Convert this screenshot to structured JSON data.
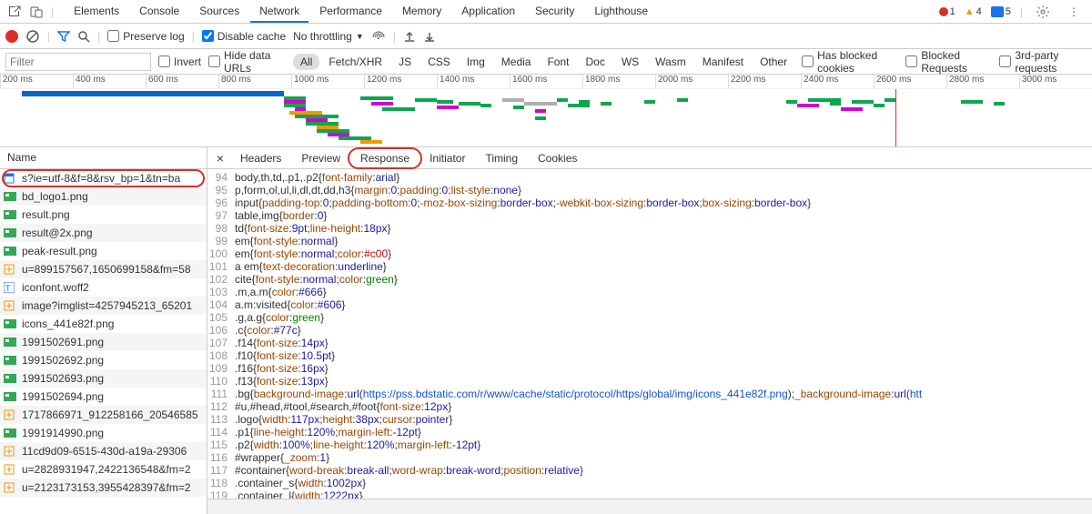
{
  "top_tabs": {
    "items": [
      "Elements",
      "Console",
      "Sources",
      "Network",
      "Performance",
      "Memory",
      "Application",
      "Security",
      "Lighthouse"
    ],
    "active_index": 3
  },
  "top_right": {
    "errors": "1",
    "warnings": "4",
    "messages": "5"
  },
  "net_toolbar": {
    "preserve_log": "Preserve log",
    "disable_cache": "Disable cache",
    "throttling": "No throttling"
  },
  "filter_bar": {
    "filter_placeholder": "Filter",
    "invert": "Invert",
    "hide_data_urls": "Hide data URLs",
    "types": [
      "All",
      "Fetch/XHR",
      "JS",
      "CSS",
      "Img",
      "Media",
      "Font",
      "Doc",
      "WS",
      "Wasm",
      "Manifest",
      "Other"
    ],
    "has_blocked_cookies": "Has blocked cookies",
    "blocked_requests": "Blocked Requests",
    "third_party": "3rd-party requests"
  },
  "timeline_ticks": [
    "200 ms",
    "400 ms",
    "600 ms",
    "800 ms",
    "1000 ms",
    "1200 ms",
    "1400 ms",
    "1600 ms",
    "1800 ms",
    "2000 ms",
    "2200 ms",
    "2400 ms",
    "2600 ms",
    "2800 ms",
    "3000 ms"
  ],
  "name_header": "Name",
  "requests": [
    {
      "icon": "doc",
      "name": "s?ie=utf-8&f=8&rsv_bp=1&tn=ba"
    },
    {
      "icon": "img",
      "name": "bd_logo1.png"
    },
    {
      "icon": "img",
      "name": "result.png"
    },
    {
      "icon": "img",
      "name": "result@2x.png"
    },
    {
      "icon": "img",
      "name": "peak-result.png"
    },
    {
      "icon": "other",
      "name": "u=899157567,1650699158&fm=58"
    },
    {
      "icon": "font",
      "name": "iconfont.woff2"
    },
    {
      "icon": "other",
      "name": "image?imglist=4257945213_65201"
    },
    {
      "icon": "img",
      "name": "icons_441e82f.png"
    },
    {
      "icon": "img",
      "name": "1991502691.png"
    },
    {
      "icon": "img",
      "name": "1991502692.png"
    },
    {
      "icon": "img",
      "name": "1991502693.png"
    },
    {
      "icon": "img",
      "name": "1991502694.png"
    },
    {
      "icon": "other",
      "name": "1717866971_912258166_20546585"
    },
    {
      "icon": "img",
      "name": "1991914990.png"
    },
    {
      "icon": "other",
      "name": "11cd9d09-6515-430d-a19a-29306"
    },
    {
      "icon": "other",
      "name": "u=2828931947,2422136548&fm=2"
    },
    {
      "icon": "other",
      "name": "u=2123173153,3955428397&fm=2"
    }
  ],
  "detail_tabs": {
    "items": [
      "Headers",
      "Preview",
      "Response",
      "Initiator",
      "Timing",
      "Cookies"
    ],
    "active_index": 2
  },
  "code_lines": [
    {
      "n": 94,
      "html": "body,th,td,.p1,.p2{<span class='prop'>font-family</span>:<span class='val'>arial</span>}"
    },
    {
      "n": 95,
      "html": "p,form,ol,ul,li,dl,dt,dd,h3{<span class='prop'>margin</span>:<span class='num'>0</span>;<span class='prop'>padding</span>:<span class='num'>0</span>;<span class='prop'>list-style</span>:<span class='val'>none</span>}"
    },
    {
      "n": 96,
      "html": "input{<span class='prop'>padding-top</span>:<span class='num'>0</span>;<span class='prop'>padding-bottom</span>:<span class='num'>0</span>;<span class='prop'>-moz-box-sizing</span>:<span class='val'>border-box</span>;<span class='prop'>-webkit-box-sizing</span>:<span class='val'>border-box</span>;<span class='prop'>box-sizing</span>:<span class='val'>border-box</span>}"
    },
    {
      "n": 97,
      "html": "table,img{<span class='prop'>border</span>:<span class='num'>0</span>}"
    },
    {
      "n": 98,
      "html": "td{<span class='prop'>font-size</span>:<span class='num'>9pt</span>;<span class='prop'>line-height</span>:<span class='num'>18px</span>}"
    },
    {
      "n": 99,
      "html": "em{<span class='prop'>font-style</span>:<span class='val'>normal</span>}"
    },
    {
      "n": 100,
      "html": "em{<span class='prop'>font-style</span>:<span class='val'>normal</span>;<span class='prop'>color</span>:<span class='sel'>#c00</span>}"
    },
    {
      "n": 101,
      "html": "a em{<span class='prop'>text-decoration</span>:<span class='val'>underline</span>}"
    },
    {
      "n": 102,
      "html": "cite{<span class='prop'>font-style</span>:<span class='val'>normal</span>;<span class='prop'>color</span>:<span class='green'>green</span>}"
    },
    {
      "n": 103,
      "html": ".m,a.m{<span class='prop'>color</span>:<span class='hexc'>#666</span>}"
    },
    {
      "n": 104,
      "html": "a.m:visited{<span class='prop'>color</span>:<span class='hexc'>#606</span>}"
    },
    {
      "n": 105,
      "html": ".g,a.g{<span class='prop'>color</span>:<span class='green'>green</span>}"
    },
    {
      "n": 106,
      "html": ".c{<span class='prop'>color</span>:<span class='hexc'>#77c</span>}"
    },
    {
      "n": 107,
      "html": ".f14{<span class='prop'>font-size</span>:<span class='num'>14px</span>}"
    },
    {
      "n": 108,
      "html": ".f10{<span class='prop'>font-size</span>:<span class='num'>10.5pt</span>}"
    },
    {
      "n": 109,
      "html": ".f16{<span class='prop'>font-size</span>:<span class='num'>16px</span>}"
    },
    {
      "n": 110,
      "html": ".f13{<span class='prop'>font-size</span>:<span class='num'>13px</span>}"
    },
    {
      "n": 111,
      "html": ".bg{<span class='prop'>background-image</span>:<span class='fn'>url</span>(<span class='url'>https://pss.bdstatic.com/r/www/cache/static/protocol/https/global/img/icons_441e82f.png</span>);<span class='prop'>_background-image</span>:<span class='fn'>url</span>(<span class='url'>htt</span>"
    },
    {
      "n": 112,
      "html": "#u,#head,#tool,#search,#foot{<span class='prop'>font-size</span>:<span class='num'>12px</span>}"
    },
    {
      "n": 113,
      "html": ".logo{<span class='prop'>width</span>:<span class='num'>117px</span>;<span class='prop'>height</span>:<span class='num'>38px</span>;<span class='prop'>cursor</span>:<span class='val'>pointer</span>}"
    },
    {
      "n": 114,
      "html": ".p1{<span class='prop'>line-height</span>:<span class='num'>120%</span>;<span class='prop'>margin-left</span>:<span class='num'>-12pt</span>}"
    },
    {
      "n": 115,
      "html": ".p2{<span class='prop'>width</span>:<span class='num'>100%</span>;<span class='prop'>line-height</span>:<span class='num'>120%</span>;<span class='prop'>margin-left</span>:<span class='num'>-12pt</span>}"
    },
    {
      "n": 116,
      "html": "#wrapper{<span class='prop'>_zoom</span>:<span class='num'>1</span>}"
    },
    {
      "n": 117,
      "html": "#container{<span class='prop'>word-break</span>:<span class='val'>break-all</span>;<span class='prop'>word-wrap</span>:<span class='val'>break-word</span>;<span class='prop'>position</span>:<span class='val'>relative</span>}"
    },
    {
      "n": 118,
      "html": ".container_s{<span class='prop'>width</span>:<span class='num'>1002px</span>}"
    },
    {
      "n": 119,
      "html": ".container_l{<span class='prop'>width</span>:<span class='num'>1222px</span>}"
    }
  ]
}
